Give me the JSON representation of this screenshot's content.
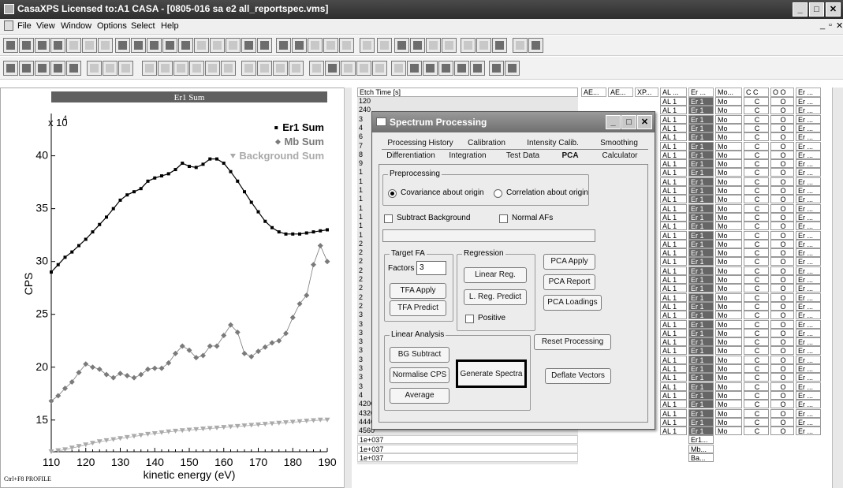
{
  "window": {
    "title": "CasaXPS Licensed to:A1 CASA - [0805-016 sa e2 all_reportspec.vms]"
  },
  "menu": {
    "items": [
      "File",
      "View",
      "Window",
      "Options",
      "Select",
      "Help"
    ]
  },
  "graph": {
    "panel_title": "Er1 Sum",
    "footer_note": "Ctrl+F8 PROFILE",
    "chart_data": {
      "type": "line",
      "xlabel": "kinetic energy (eV)",
      "ylabel": "CPS",
      "y_multiplier_label": "x 10",
      "y_multiplier_exp": "4",
      "xlim": [
        110,
        190
      ],
      "ylim": [
        12,
        44
      ],
      "x_ticks": [
        "110",
        "120",
        "130",
        "140",
        "150",
        "160",
        "170",
        "180",
        "190"
      ],
      "y_ticks": [
        "15",
        "20",
        "25",
        "30",
        "35",
        "40"
      ],
      "legend": {
        "placement": "top-right"
      },
      "series": [
        {
          "name": "Er1 Sum",
          "color": "#000000",
          "marker": "square",
          "x": [
            110,
            112,
            114,
            116,
            118,
            120,
            122,
            124,
            126,
            128,
            130,
            132,
            134,
            136,
            138,
            140,
            142,
            144,
            146,
            148,
            150,
            152,
            154,
            156,
            158,
            160,
            162,
            164,
            166,
            168,
            170,
            172,
            174,
            176,
            178,
            180,
            182,
            184,
            186,
            188,
            190
          ],
          "y": [
            29.0,
            29.7,
            30.4,
            30.9,
            31.5,
            32.1,
            32.8,
            33.5,
            34.2,
            35.0,
            35.8,
            36.3,
            36.6,
            36.9,
            37.6,
            37.9,
            38.1,
            38.3,
            38.7,
            39.3,
            39.0,
            38.9,
            39.2,
            39.7,
            39.7,
            39.3,
            38.5,
            37.6,
            36.6,
            35.6,
            34.7,
            33.8,
            33.2,
            32.8,
            32.6,
            32.6,
            32.6,
            32.7,
            32.8,
            32.9,
            33.0
          ]
        },
        {
          "name": "Mb Sum",
          "color": "#7a7a7a",
          "marker": "diamond",
          "x": [
            110,
            112,
            114,
            116,
            118,
            120,
            122,
            124,
            126,
            128,
            130,
            132,
            134,
            136,
            138,
            140,
            142,
            144,
            146,
            148,
            150,
            152,
            154,
            156,
            158,
            160,
            162,
            164,
            166,
            168,
            170,
            172,
            174,
            176,
            178,
            180,
            182,
            184,
            186,
            188,
            190
          ],
          "y": [
            16.8,
            17.3,
            18.0,
            18.6,
            19.5,
            20.3,
            20.0,
            19.8,
            19.3,
            19.0,
            19.4,
            19.2,
            19.0,
            19.3,
            19.8,
            19.9,
            19.9,
            20.4,
            21.3,
            22.0,
            21.6,
            20.9,
            21.1,
            22.0,
            22.0,
            23.0,
            24.0,
            23.3,
            21.3,
            21.0,
            21.5,
            21.9,
            22.3,
            22.5,
            23.2,
            24.7,
            26.0,
            26.8,
            29.7,
            31.5,
            30.0
          ]
        },
        {
          "name": "Background Sum",
          "color": "#aaaaaa",
          "marker": "triangle-down",
          "x": [
            110,
            112,
            114,
            116,
            118,
            120,
            122,
            124,
            126,
            128,
            130,
            132,
            134,
            136,
            138,
            140,
            142,
            144,
            146,
            148,
            150,
            152,
            154,
            156,
            158,
            160,
            162,
            164,
            166,
            168,
            170,
            172,
            174,
            176,
            178,
            180,
            182,
            184,
            186,
            188,
            190
          ],
          "y": [
            12.0,
            12.1,
            12.2,
            12.35,
            12.5,
            12.65,
            12.8,
            12.95,
            13.05,
            13.15,
            13.25,
            13.35,
            13.45,
            13.55,
            13.65,
            13.72,
            13.8,
            13.88,
            13.95,
            14.0,
            14.05,
            14.1,
            14.15,
            14.2,
            14.25,
            14.3,
            14.35,
            14.4,
            14.45,
            14.5,
            14.55,
            14.6,
            14.65,
            14.7,
            14.75,
            14.8,
            14.85,
            14.9,
            14.95,
            15.0,
            15.0
          ]
        }
      ]
    }
  },
  "dialog": {
    "title": "Spectrum Processing",
    "tabs_row1": [
      "Processing History",
      "Calibration",
      "Intensity Calib.",
      "Smoothing"
    ],
    "tabs_row2": [
      "Differentiation",
      "Integration",
      "Test Data",
      "PCA",
      "Calculator"
    ],
    "active_tab": "PCA",
    "preprocessing": {
      "legend": "Preprocessing",
      "option1": "Covariance about origin",
      "option2": "Correlation about origin"
    },
    "subtract_background": "Subtract Background",
    "normal_afs": "Normal AFs",
    "target_fa": {
      "legend": "Target FA",
      "factors_label": "Factors",
      "factors_value": "3",
      "tfa_apply": "TFA Apply",
      "tfa_predict": "TFA Predict"
    },
    "regression": {
      "legend": "Regression",
      "linear_reg": "Linear Reg.",
      "l_reg_predict": "L. Reg. Predict",
      "positive": "Positive"
    },
    "pca_apply": "PCA Apply",
    "pca_report": "PCA Report",
    "pca_loadings": "PCA Loadings",
    "reset_processing": "Reset Processing",
    "linear_analysis": {
      "legend": "Linear Analysis",
      "bg_subtract": "BG Subtract",
      "normalise_cps": "Normalise CPS",
      "average": "Average"
    },
    "generate_spectra": "Generate Spectra",
    "deflate_vectors": "Deflate Vectors"
  },
  "table": {
    "headers": [
      "Etch Time [s]",
      "AE...",
      "AE...",
      "XP...",
      "AL ...",
      "Er ...",
      "Mo...",
      "C C",
      "O O",
      "Er ..."
    ],
    "etch_values": [
      "120",
      "240",
      "3",
      "4",
      "6",
      "7",
      "8",
      "9",
      "1",
      "1",
      "1",
      "1",
      "1",
      "1",
      "1",
      "1",
      "2",
      "2",
      "2",
      "2",
      "2",
      "2",
      "2",
      "2",
      "3",
      "3",
      "3",
      "3",
      "3",
      "3",
      "3",
      "3",
      "3",
      "4",
      "4200",
      "4320",
      "4440",
      "4560",
      "1e+037",
      "1e+037",
      "1e+037"
    ],
    "row_values": {
      "al": "AL 1",
      "er": "Er 1",
      "mo": "Mo",
      "c": "C",
      "o": "O",
      "er2": "Er ..."
    },
    "extra_er_cells": [
      "Er1...",
      "Mb...",
      "Ba..."
    ]
  }
}
